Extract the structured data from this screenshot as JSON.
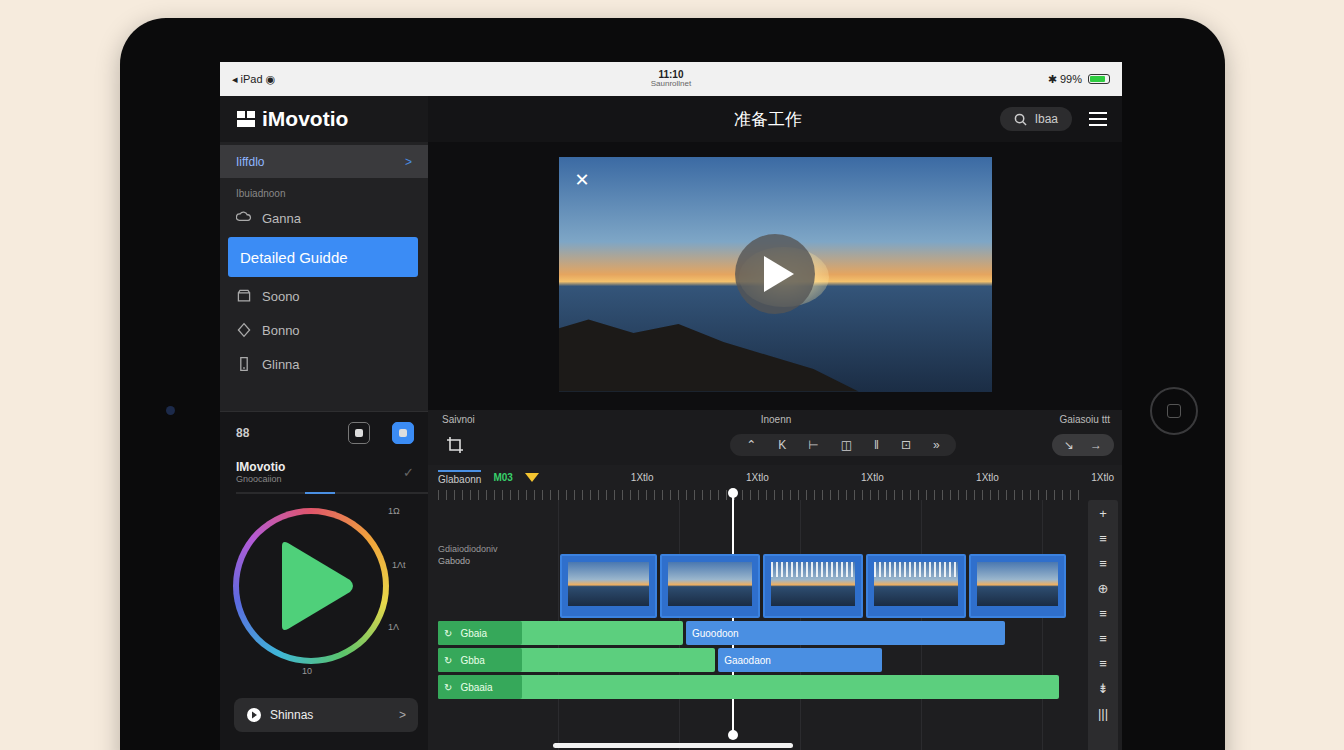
{
  "status_bar": {
    "left": "◂ iPad ◉",
    "time": "11:10",
    "subtitle": "Saunrollnet",
    "right": "✱ 99%",
    "battery_level": 0.85
  },
  "header": {
    "logo": "iMovotio",
    "title": "准备工作",
    "search_label": "Ibaa"
  },
  "sidebar": {
    "top_item": {
      "label": "Iiffdlo",
      "chevron": ">"
    },
    "section": "Ibuiadnoon",
    "items": [
      {
        "label": "Ganna",
        "selected": false
      },
      {
        "label": "Detailed Guidde",
        "selected": true
      },
      {
        "label": "Soono",
        "selected": false
      },
      {
        "label": "Bonno",
        "selected": false
      },
      {
        "label": "Glinna",
        "selected": false
      }
    ]
  },
  "panel": {
    "tool_text": "88",
    "tool_buttons": [
      {
        "selected": false
      },
      {
        "selected": true
      }
    ],
    "title": "IMovotio",
    "subtitle": "Gnoocaiion",
    "check": "✓",
    "ring_labels": [
      "1Ω",
      "1Λt",
      "1Λ",
      "10"
    ],
    "button": {
      "label": "Shinnas",
      "chevron": ">"
    }
  },
  "preview": {
    "close": "✕"
  },
  "toolbar": {
    "left_label": "Saivnoi",
    "center_label": "Inoenn",
    "right_label": "Gaiasoiu ttt",
    "controls": [
      "⌃",
      "K",
      "⊢",
      "◫",
      "‖",
      "⊡",
      "»"
    ],
    "right_controls": [
      "↘",
      "→"
    ]
  },
  "timeline": {
    "ruler_label": "Glabaonn",
    "marker": "M03",
    "times": [
      "1Xtlo",
      "1Xtlo",
      "1Xtlo",
      "1Xtlo",
      "1Xtlo"
    ],
    "track_label": "Gdiaiodiodoniv",
    "track_sublabel": "Gabodo",
    "playhead": 0.457,
    "clips": [
      {
        "kind": "photo",
        "start": 19,
        "end": 34
      },
      {
        "kind": "photo",
        "start": 34.5,
        "end": 50
      },
      {
        "kind": "waveform",
        "start": 50.5,
        "end": 66
      },
      {
        "kind": "waveform",
        "start": 66.5,
        "end": 82
      },
      {
        "kind": "photo",
        "start": 82.5,
        "end": 97.5
      }
    ],
    "audio_tracks": [
      {
        "prefix": "↻",
        "label": "Gbaia",
        "segments": [
          {
            "start": 0,
            "end": 38,
            "label": "",
            "color": "#5ccf7e"
          },
          {
            "start": 38.5,
            "end": 88,
            "label": "Guoodoon",
            "color": "#4a8fe2"
          }
        ]
      },
      {
        "prefix": "↻",
        "label": "Gbba",
        "segments": [
          {
            "start": 0,
            "end": 43,
            "label": "",
            "color": "#5ccf7e"
          },
          {
            "start": 43.5,
            "end": 69,
            "label": "Gaaodaon",
            "color": "#4a8fe2"
          }
        ]
      },
      {
        "prefix": "↻",
        "label": "Gbaaia",
        "segments": [
          {
            "start": 0,
            "end": 96.5,
            "label": "",
            "color": "#5ccf7e"
          }
        ]
      }
    ],
    "tools": [
      "+",
      "≡",
      "≡",
      "⊕",
      "≡",
      "≡",
      "≡",
      "⇟",
      "|||"
    ]
  }
}
